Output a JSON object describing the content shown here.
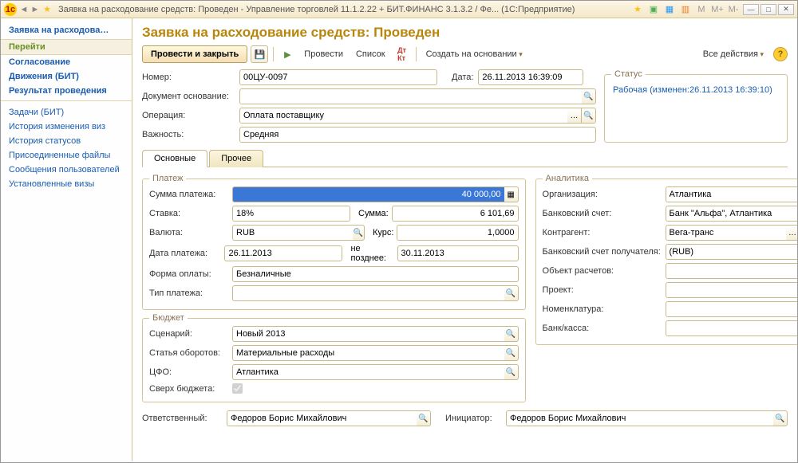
{
  "titlebar": {
    "title": "Заявка на расходование средств: Проведен - Управление торговлей 11.1.2.22 + БИТ.ФИНАНС 3.1.3.2 / Фе...    (1С:Предприятие)",
    "mem_labels": [
      "M",
      "M+",
      "M-"
    ]
  },
  "sidebar": {
    "active": "Заявка на расходова…",
    "section1": "Перейти",
    "items1": [
      "Согласование",
      "Движения (БИТ)",
      "Результат проведения"
    ],
    "items2": [
      "Задачи (БИТ)",
      "История изменения виз",
      "История статусов",
      "Присоединенные файлы",
      "Сообщения пользователей",
      "Установленные визы"
    ]
  },
  "header": {
    "title": "Заявка на расходование средств: Проведен",
    "btn_conduct_close": "Провести и закрыть",
    "btn_conduct": "Провести",
    "btn_list": "Список",
    "btn_create_based": "Создать на основании",
    "btn_all_actions": "Все действия"
  },
  "top_form": {
    "number_label": "Номер:",
    "number": "00ЦУ-0097",
    "date_label": "Дата:",
    "date": "26.11.2013 16:39:09",
    "basis_label": "Документ основание:",
    "basis": "",
    "operation_label": "Операция:",
    "operation": "Оплата поставщику",
    "importance_label": "Важность:",
    "importance": "Средняя"
  },
  "status": {
    "legend": "Статус",
    "text": "Рабочая (изменен:26.11.2013 16:39:10)"
  },
  "tabs": {
    "main": "Основные",
    "other": "Прочее"
  },
  "payment": {
    "legend": "Платеж",
    "amount_label": "Сумма платежа:",
    "amount": "40 000,00",
    "rate_label": "Ставка:",
    "rate": "18%",
    "sum_label": "Сумма:",
    "sum": "6 101,69",
    "currency_label": "Валюта:",
    "currency": "RUB",
    "course_label": "Курс:",
    "course": "1,0000",
    "pay_date_label": "Дата платежа:",
    "pay_date": "26.11.2013",
    "no_later_label": "не позднее:",
    "no_later": "30.11.2013",
    "pay_form_label": "Форма оплаты:",
    "pay_form": "Безналичные",
    "pay_type_label": "Тип платежа:",
    "pay_type": ""
  },
  "analytics": {
    "legend": "Аналитика",
    "org_label": "Организация:",
    "org": "Атлантика",
    "bank_acc_label": "Банковский счет:",
    "bank_acc": "Банк \"Альфа\", Атлантика",
    "counterparty_label": "Контрагент:",
    "counterparty": "Вега-транс",
    "recv_bank_label": "Банковский счет получателя:",
    "recv_bank": "(RUB)",
    "calc_obj_label": "Объект расчетов:",
    "calc_obj": "",
    "project_label": "Проект:",
    "project": "",
    "nomen_label": "Номенклатура:",
    "nomen": "",
    "bank_cash_label": "Банк/касса:",
    "bank_cash": ""
  },
  "budget": {
    "legend": "Бюджет",
    "scenario_label": "Сценарий:",
    "scenario": "Новый 2013",
    "turnover_label": "Статья оборотов:",
    "turnover": "Материальные расходы",
    "cfo_label": "ЦФО:",
    "cfo": "Атлантика",
    "over_label": "Сверх бюджета:"
  },
  "footer": {
    "responsible_label": "Ответственный:",
    "responsible": "Федоров Борис Михайлович",
    "initiator_label": "Инициатор:",
    "initiator": "Федоров Борис Михайлович"
  }
}
